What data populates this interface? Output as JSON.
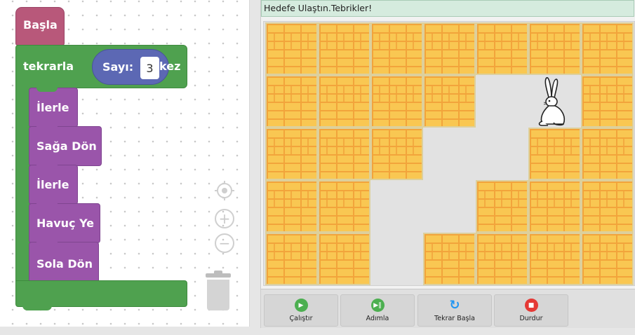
{
  "workspace": {
    "start_label": "Başla",
    "loop": {
      "prefix": "tekrarla",
      "count_label": "Sayı:",
      "count_value": "3",
      "suffix": "kez"
    },
    "commands": [
      {
        "label": "İlerle",
        "name": "forward"
      },
      {
        "label": "Sağa Dön",
        "name": "turn-right"
      },
      {
        "label": "İlerle",
        "name": "forward"
      },
      {
        "label": "Havuç Ye",
        "name": "eat-carrot"
      },
      {
        "label": "Sola Dön",
        "name": "turn-left"
      }
    ]
  },
  "game": {
    "status_text": "Hedefe Ulaştın.Tebrikler!",
    "grid": {
      "rows": [
        [
          1,
          1,
          1,
          1,
          1,
          1,
          1
        ],
        [
          1,
          1,
          1,
          1,
          0,
          0,
          1
        ],
        [
          1,
          1,
          1,
          0,
          0,
          1,
          1
        ],
        [
          1,
          1,
          0,
          0,
          1,
          1,
          1
        ],
        [
          1,
          1,
          0,
          1,
          1,
          1,
          1
        ]
      ],
      "hare_cell": {
        "row": 1,
        "col": 5
      }
    },
    "controls": [
      {
        "label": "Çalıştır",
        "name": "run-button",
        "icon": "play-icon",
        "color": "#4caf50"
      },
      {
        "label": "Adımla",
        "name": "step-button",
        "icon": "step-icon",
        "color": "#4caf50"
      },
      {
        "label": "Tekrar Başla",
        "name": "restart-button",
        "icon": "refresh-icon",
        "color": "#2196f3"
      },
      {
        "label": "Durdur",
        "name": "stop-button",
        "icon": "stop-icon",
        "color": "#e53935"
      }
    ]
  }
}
